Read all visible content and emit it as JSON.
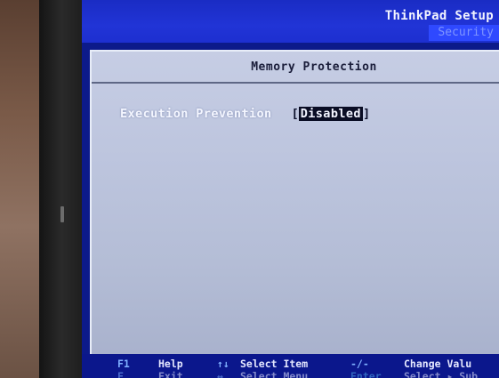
{
  "header": {
    "app_title": "ThinkPad Setup",
    "active_tab": "Security"
  },
  "panel": {
    "title": "Memory Protection",
    "settings": [
      {
        "label": "Execution Prevention",
        "value": "Disabled"
      }
    ]
  },
  "footer": {
    "line1": [
      {
        "key": "F1",
        "desc": "Help"
      },
      {
        "key": "↑↓",
        "desc": "Select Item"
      },
      {
        "key": "-/-",
        "desc": "Change Valu"
      }
    ],
    "line2": [
      {
        "key": "F",
        "desc": "Exit"
      },
      {
        "key": "↔",
        "desc": "Select Menu"
      },
      {
        "key": "Enter",
        "desc": "Select ▸ Sub"
      }
    ]
  },
  "colors": {
    "screen_bg": "#0c1a8a",
    "title_bar": "#2134d6",
    "panel_bg": "#bdc5de",
    "text_highlight": "#f4f6ff",
    "value_box": "#0a0d24"
  }
}
